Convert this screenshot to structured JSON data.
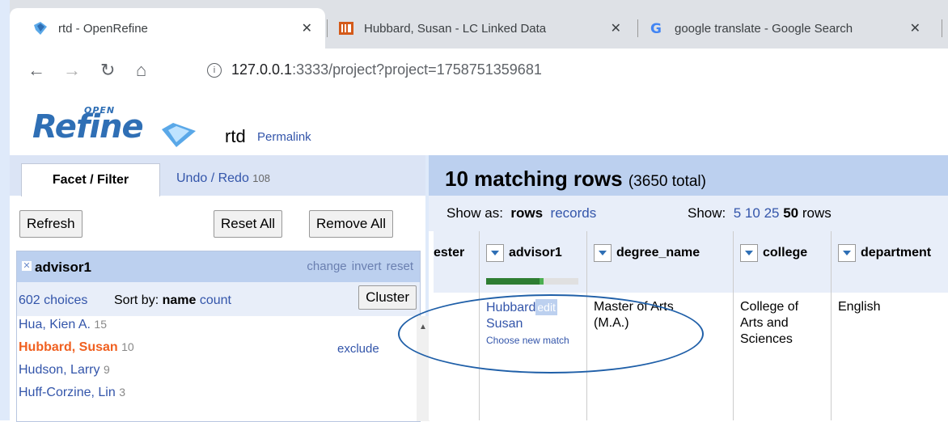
{
  "browser": {
    "tabs": [
      {
        "title": "rtd - OpenRefine",
        "active": true,
        "close": "✕"
      },
      {
        "title": "Hubbard, Susan - LC Linked Data",
        "close": "✕"
      },
      {
        "title": "google translate - Google Search",
        "close": "✕"
      }
    ],
    "url_host": "127.0.0.1",
    "url_rest": ":3333/project?project=1758751359681"
  },
  "header": {
    "logo": "Refine",
    "logo_open": "OPEN",
    "project": "rtd",
    "permalink": "Permalink"
  },
  "left": {
    "tab_facet": "Facet / Filter",
    "tab_undo": "Undo / Redo",
    "undo_count": "108",
    "refresh": "Refresh",
    "reset_all": "Reset All",
    "remove_all": "Remove All",
    "facet": {
      "title": "advisor1",
      "links": "change invert reset",
      "choices": "602 choices",
      "sort_by": "Sort by:",
      "sort_name": "name",
      "sort_count": "count",
      "cluster": "Cluster",
      "items": [
        {
          "name": "Hua, Kien A.",
          "count": "15"
        },
        {
          "name": "Hubbard, Susan",
          "count": "10",
          "selected": true
        },
        {
          "name": "Hudson, Larry",
          "count": "9"
        },
        {
          "name": "Huff-Corzine, Lin",
          "count": "3"
        }
      ],
      "exclude": "exclude"
    }
  },
  "right": {
    "matching": "10 matching rows",
    "total": "(3650 total)",
    "show_as": "Show as:",
    "rows": "rows",
    "records": "records",
    "show": "Show:",
    "n5": "5",
    "n10": "10",
    "n25": "25",
    "n50": "50",
    "rows_word": "rows",
    "columns": [
      "ester",
      "advisor1",
      "degree_name",
      "college",
      "department"
    ],
    "advisor_match_fraction": 0.62,
    "cells": {
      "advisor_line1": "Hubbard",
      "advisor_edit": "edit",
      "advisor_line2": "Susan",
      "advisor_choose": "Choose new match",
      "degree": "Master of Arts (M.A.)",
      "college": "College of Arts and Sciences",
      "department": "English"
    }
  }
}
